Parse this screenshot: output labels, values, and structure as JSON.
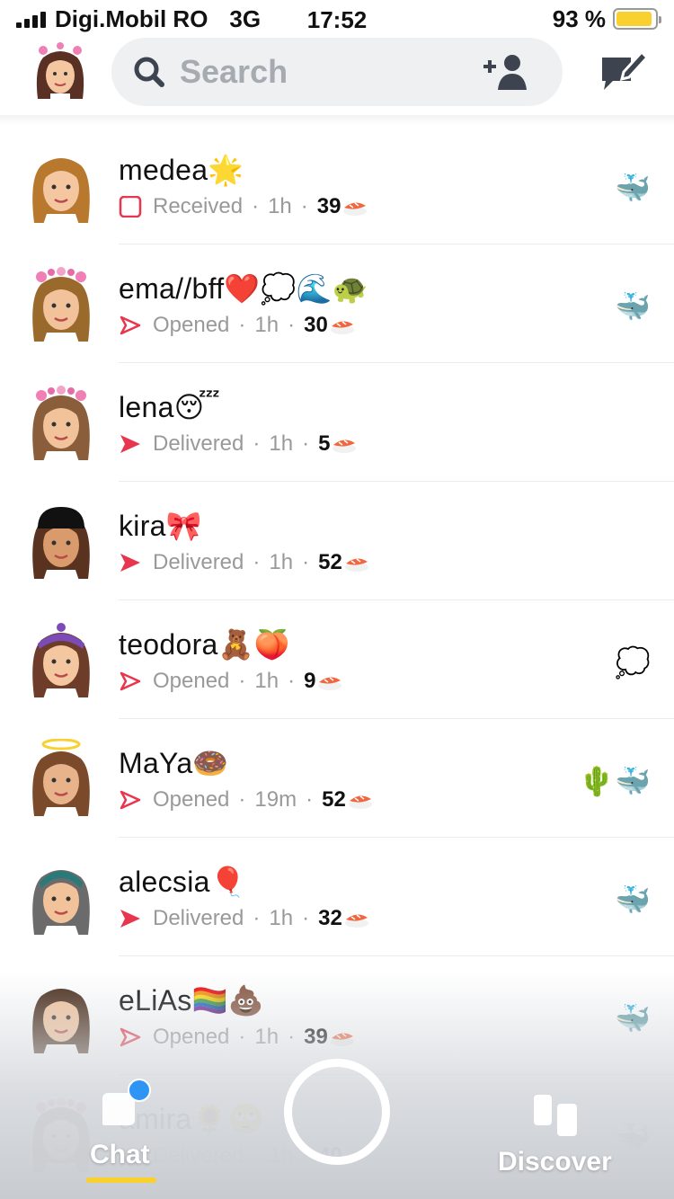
{
  "status_bar": {
    "carrier": "Digi.Mobil RO",
    "network": "3G",
    "time": "17:52",
    "battery": "93 %",
    "battery_level": 0.93
  },
  "header": {
    "search_placeholder": "Search"
  },
  "chats": [
    {
      "name": "medea🌟",
      "status": "Received",
      "status_type": "received",
      "time": "1h",
      "streak": "39",
      "right_icons": "🐳",
      "hair": "#b8792f",
      "skin": "#f4c7a1",
      "headpiece": ""
    },
    {
      "name": "ema//bff❤️💭🌊🐢",
      "status": "Opened",
      "status_type": "opened",
      "time": "1h",
      "streak": "30",
      "right_icons": "🐳",
      "hair": "#9a6a2c",
      "skin": "#f2c29b",
      "headpiece": "flowers"
    },
    {
      "name": "lena😴",
      "status": "Delivered",
      "status_type": "delivered",
      "time": "1h",
      "streak": "5",
      "right_icons": "",
      "hair": "#8a5e3a",
      "skin": "#f2c29b",
      "headpiece": "hearts"
    },
    {
      "name": "kira🎀",
      "status": "Delivered",
      "status_type": "delivered",
      "time": "1h",
      "streak": "52",
      "right_icons": "",
      "hair": "#5a3320",
      "skin": "#d99a6c",
      "headpiece": "cap"
    },
    {
      "name": "teodora🧸🍑",
      "status": "Opened",
      "status_type": "opened",
      "time": "1h",
      "streak": "9",
      "right_icons": "💭",
      "hair": "#6e3d2a",
      "skin": "#f4c7a1",
      "headpiece": "bandana"
    },
    {
      "name": "MaYa🍩",
      "status": "Opened",
      "status_type": "opened",
      "time": "19m",
      "streak": "52",
      "right_icons": "🌵🐳",
      "hair": "#7a4a2a",
      "skin": "#e8b38a",
      "headpiece": "halo"
    },
    {
      "name": "alecsia🎈",
      "status": "Delivered",
      "status_type": "delivered",
      "time": "1h",
      "streak": "32",
      "right_icons": "🐳",
      "hair": "#6b6b6b",
      "skin": "#f2c29b",
      "headpiece": "scarf"
    },
    {
      "name": "eLiAs🏳️‍🌈💩",
      "status": "Opened",
      "status_type": "opened",
      "time": "1h",
      "streak": "39",
      "right_icons": "🐳",
      "hair": "#4a2e1c",
      "skin": "#f1c49d",
      "headpiece": ""
    },
    {
      "name": "amira🌻🙄",
      "status": "Delivered",
      "status_type": "delivered",
      "time": "1h",
      "streak": "40",
      "right_icons": "🐳",
      "hair": "#6a4030",
      "skin": "#f2c29b",
      "headpiece": "hearts"
    }
  ],
  "nav": {
    "chat_label": "Chat",
    "discover_label": "Discover"
  },
  "colors": {
    "accent_yellow": "#f8d12e",
    "status_red": "#e8364f",
    "notification_blue": "#2f95f4"
  }
}
